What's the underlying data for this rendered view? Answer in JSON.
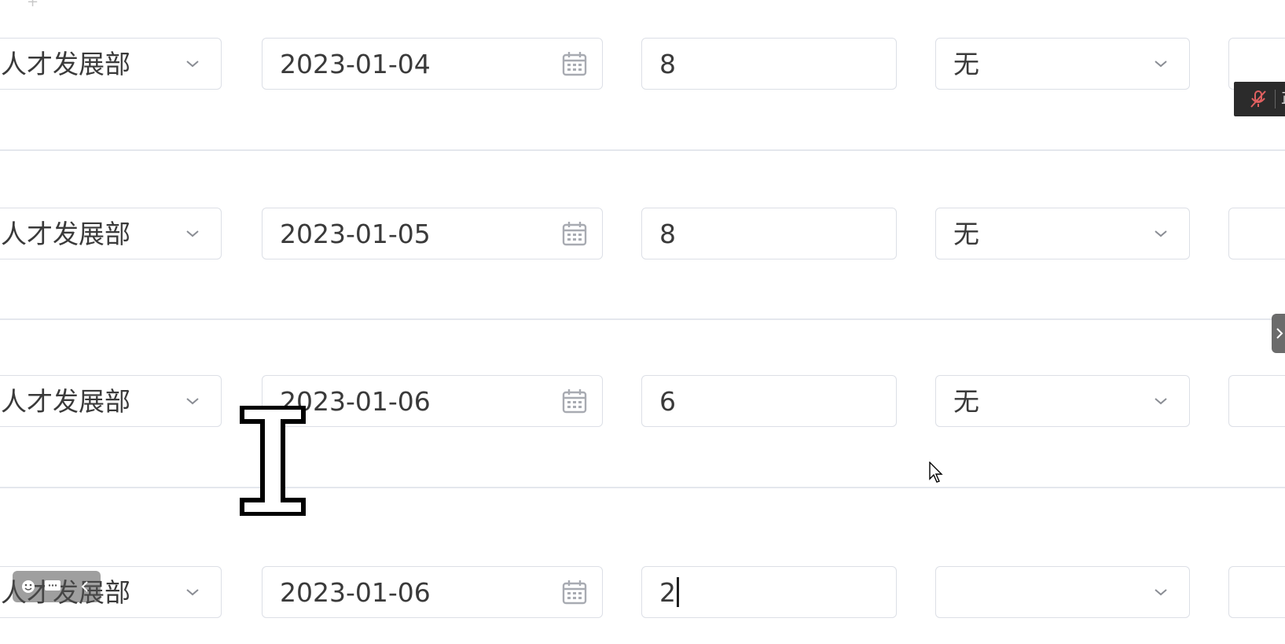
{
  "rows": [
    {
      "department": "人才发展部",
      "date": "2023-01-04",
      "hours": "8",
      "type": "无"
    },
    {
      "department": "人才发展部",
      "date": "2023-01-05",
      "hours": "8",
      "type": "无"
    },
    {
      "department": "人才发展部",
      "date": "2023-01-06",
      "hours": "6",
      "type": "无"
    },
    {
      "department": "人才发展部",
      "date": "2023-01-06",
      "hours": "2",
      "type": ""
    }
  ],
  "top_mark": "+",
  "recorder": {
    "text": "正"
  },
  "icons": {
    "dropdown": "chevron-down-icon",
    "date_picker": "calendar-icon",
    "recorder_mic": "mic-off-icon",
    "side_toggle": "chevron-right-icon",
    "text_cursor": "i-beam-cursor-icon",
    "pointer_cursor": "arrow-cursor-icon"
  },
  "colors": {
    "border": "#dcdfe6",
    "divider": "#e4e7ed",
    "text": "#3a3a3a",
    "icon": "#a8abb2",
    "recorder_bg": "#2b2b2b"
  }
}
